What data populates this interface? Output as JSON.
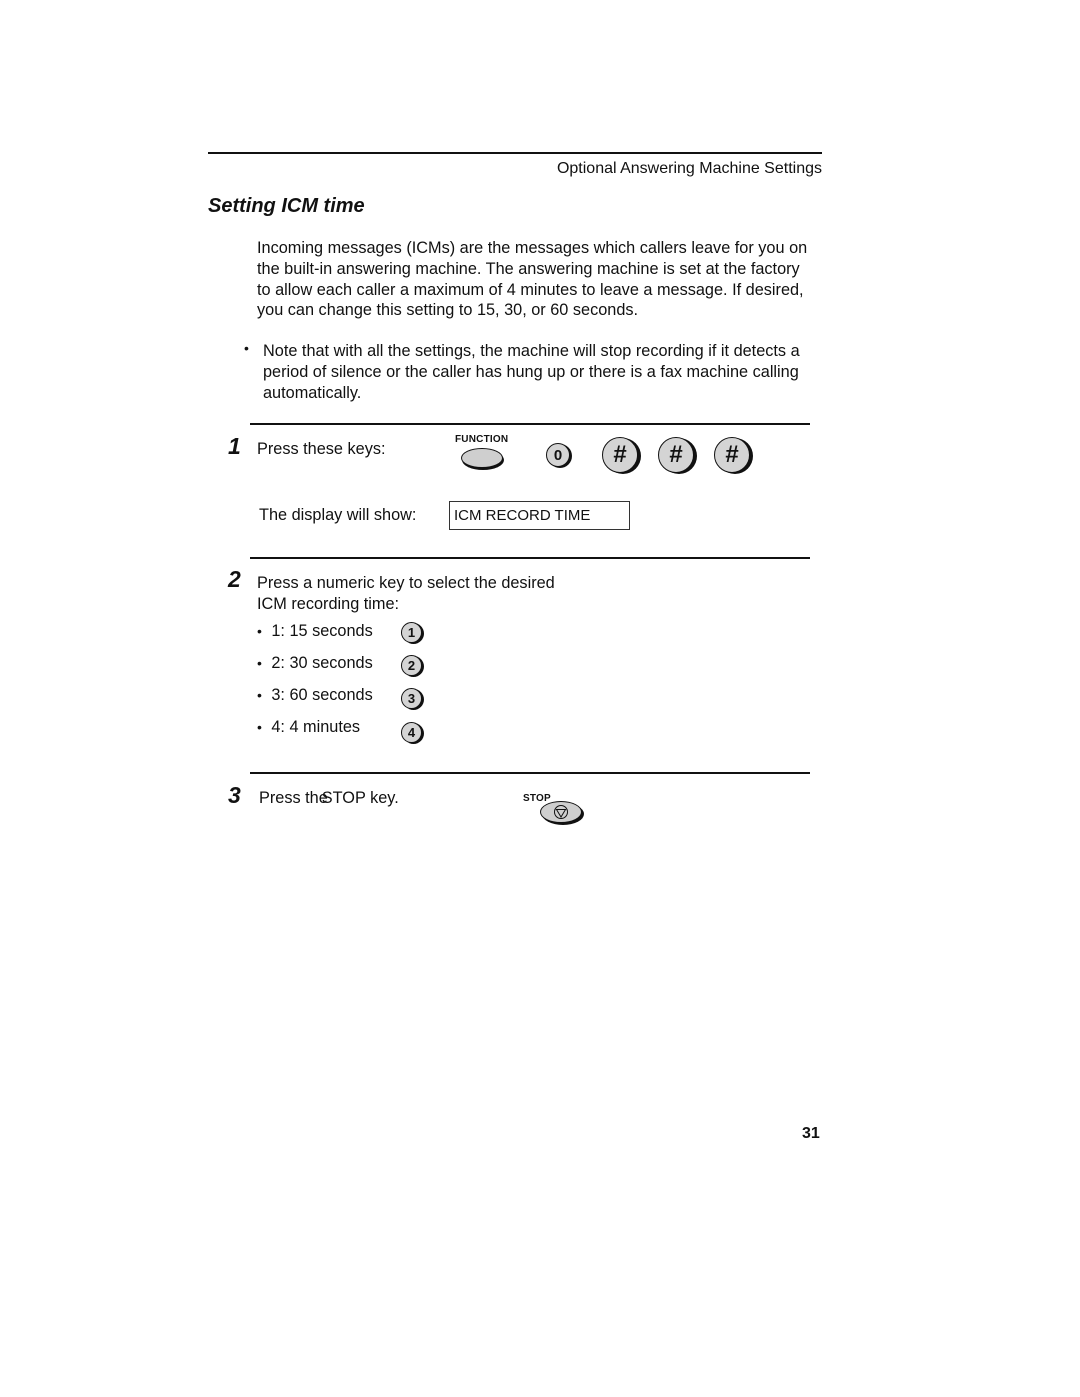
{
  "header": {
    "section_title": "Optional Answering Machine Settings"
  },
  "title": "Setting ICM time",
  "intro": {
    "lines": [
      "Incoming messages (ICMs) are the messages which callers leave for you on",
      "the built-in answering machine. The answering machine is set at the factory",
      "to allow each caller a maximum of 4 minutes to leave a message. If desired,",
      "you can change this setting to 15, 30, or 60 seconds."
    ]
  },
  "note": {
    "bullet": "•",
    "lines": [
      "Note that with all the settings, the machine will stop recording if it detects a",
      "period of silence or the caller has hung up or there is a fax machine calling",
      "automatically."
    ]
  },
  "steps": [
    {
      "number": "1",
      "text": "Press these keys:",
      "keys": {
        "function_label": "FUNCTION",
        "zero": "0",
        "hash": "#"
      },
      "display_label": "The display will show:",
      "display_value": "ICM RECORD TIME"
    },
    {
      "number": "2",
      "lines": [
        "Press a numeric key to select the desired",
        "ICM recording time:"
      ],
      "options": [
        {
          "bullet": "•",
          "text": "1: 15 seconds",
          "key": "1"
        },
        {
          "bullet": "•",
          "text": "2: 30 seconds",
          "key": "2"
        },
        {
          "bullet": "•",
          "text": "3: 60 seconds",
          "key": "3"
        },
        {
          "bullet": "•",
          "text": "4: 4 minutes",
          "key": "4"
        }
      ]
    },
    {
      "number": "3",
      "text_before": "Press the",
      "text_key": "STOP",
      "text_after": "key.",
      "stop_label": "STOP"
    }
  ],
  "page_number": "31"
}
